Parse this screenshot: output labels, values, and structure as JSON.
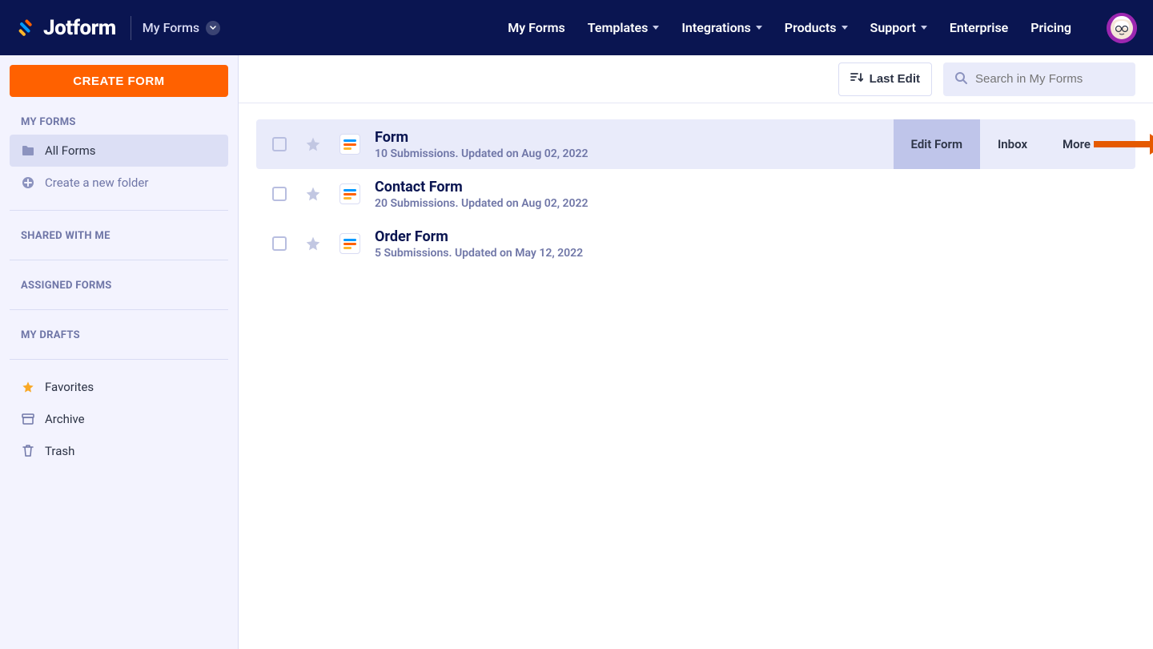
{
  "header": {
    "brand": "Jotform",
    "context": "My Forms",
    "nav": {
      "my_forms": "My Forms",
      "templates": "Templates",
      "integrations": "Integrations",
      "products": "Products",
      "support": "Support",
      "enterprise": "Enterprise",
      "pricing": "Pricing"
    }
  },
  "sidebar": {
    "create_label": "CREATE FORM",
    "sections": {
      "my_forms": "MY FORMS",
      "shared": "SHARED WITH ME",
      "assigned": "ASSIGNED FORMS",
      "drafts": "MY DRAFTS"
    },
    "all_forms": "All Forms",
    "new_folder": "Create a new folder",
    "favorites": "Favorites",
    "archive": "Archive",
    "trash": "Trash"
  },
  "toolbar": {
    "last_edit": "Last Edit",
    "search_placeholder": "Search in My Forms"
  },
  "row_actions": {
    "edit": "Edit Form",
    "inbox": "Inbox",
    "more": "More"
  },
  "forms": [
    {
      "title": "Form",
      "sub": "10 Submissions. Updated on Aug 02, 2022"
    },
    {
      "title": "Contact Form",
      "sub": "20 Submissions. Updated on Aug 02, 2022"
    },
    {
      "title": "Order Form",
      "sub": "5 Submissions. Updated on May 12, 2022"
    }
  ]
}
